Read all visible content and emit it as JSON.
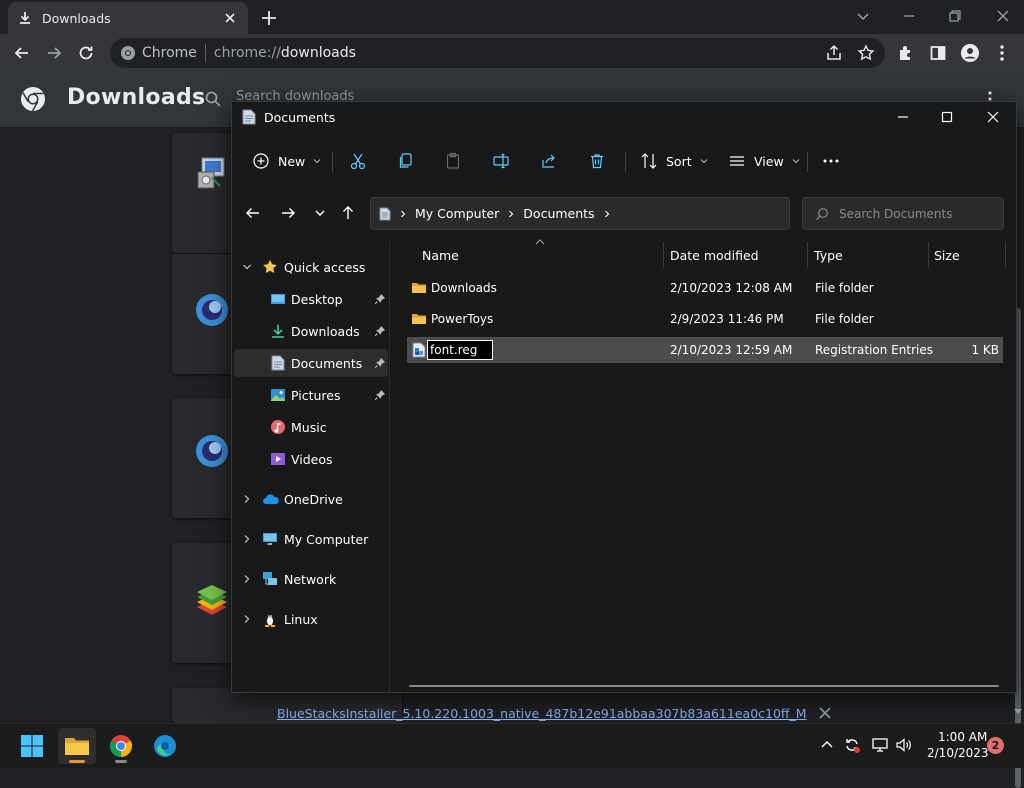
{
  "chrome": {
    "tab_title": "Downloads",
    "omnibox_site": "Chrome",
    "omnibox_url_scheme": "chrome://",
    "omnibox_url_host": "downloads"
  },
  "downloads_page": {
    "title": "Downloads",
    "search_placeholder": "Search downloads",
    "visible_file_link": "BlueStacksInstaller_5.10.220.1003_native_487b12e91abbaa307b83a611ea0c10ff_M"
  },
  "explorer": {
    "title": "Documents",
    "toolbar": {
      "new_label": "New",
      "sort_label": "Sort",
      "view_label": "View"
    },
    "address": {
      "segments": [
        "My Computer",
        "Documents"
      ]
    },
    "search_placeholder": "Search Documents",
    "sidebar": {
      "quick_access": "Quick access",
      "items": [
        {
          "label": "Desktop"
        },
        {
          "label": "Downloads"
        },
        {
          "label": "Documents"
        },
        {
          "label": "Pictures"
        },
        {
          "label": "Music"
        },
        {
          "label": "Videos"
        }
      ],
      "roots": [
        {
          "label": "OneDrive"
        },
        {
          "label": "My Computer"
        },
        {
          "label": "Network"
        },
        {
          "label": "Linux"
        }
      ]
    },
    "columns": {
      "name": "Name",
      "date": "Date modified",
      "type": "Type",
      "size": "Size"
    },
    "files": [
      {
        "name": "Downloads",
        "date": "2/10/2023 12:08 AM",
        "type": "File folder",
        "size": ""
      },
      {
        "name": "PowerToys",
        "date": "2/9/2023 11:46 PM",
        "type": "File folder",
        "size": ""
      },
      {
        "name": "font.reg",
        "date": "2/10/2023 12:59 AM",
        "type": "Registration Entries",
        "size": "1 KB"
      }
    ],
    "rename_value": "font.reg"
  },
  "taskbar": {
    "time": "1:00 AM",
    "date": "2/10/2023",
    "notification_count": "2"
  },
  "colors": {
    "accent_blue": "#60cdff",
    "folder_yellow": "#f2c14e",
    "link_blue": "#8ab4f8"
  }
}
